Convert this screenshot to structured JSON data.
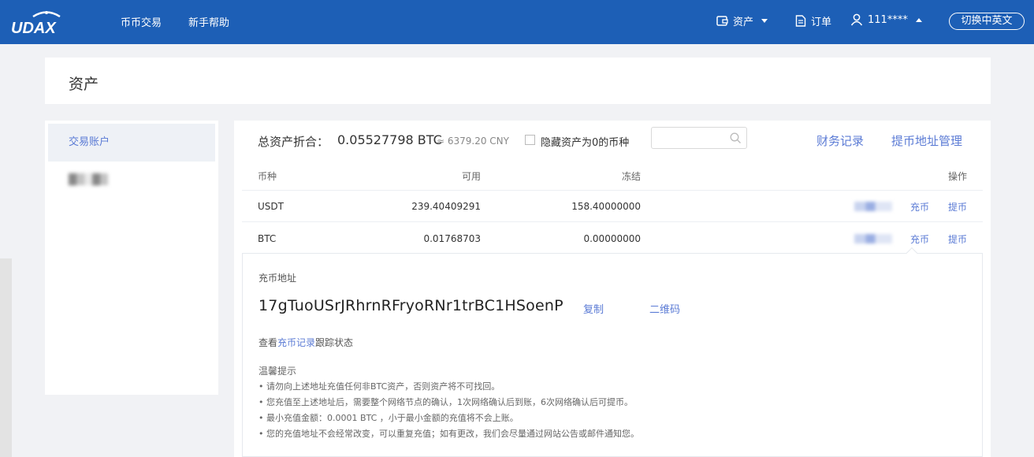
{
  "header": {
    "logo_text": "UDAX",
    "nav": [
      "币币交易",
      "新手帮助"
    ],
    "assets_label": "资产",
    "orders_label": "订单",
    "user_label": "111****",
    "lang_button": "切换中英文"
  },
  "page": {
    "title": "资产"
  },
  "sidebar": {
    "items": [
      {
        "label": "交易账户",
        "active": true
      },
      {
        "label": "█▒░█▒",
        "blurred": true
      }
    ]
  },
  "summary": {
    "total_label": "总资产折合：",
    "total_btc": "0.05527798 BTC",
    "total_cny": "≈ 6379.20 CNY",
    "hide_zero_label": "隐藏资产为0的币种",
    "search_placeholder": "",
    "finance_records": "财务记录",
    "withdraw_address_mgmt": "提币地址管理"
  },
  "table": {
    "headers": {
      "currency": "币种",
      "available": "可用",
      "frozen": "冻结",
      "action": "操作"
    },
    "rows": [
      {
        "currency": "USDT",
        "available": "239.40409291",
        "frozen": "158.40000000",
        "deposit": "充币",
        "withdraw": "提币"
      },
      {
        "currency": "BTC",
        "available": "0.01768703",
        "frozen": "0.00000000",
        "deposit": "充币",
        "withdraw": "提币"
      }
    ]
  },
  "deposit": {
    "label": "充币地址",
    "address": "17gTuoUSrJRhrnRFryoRNr1trBC1HSoenP",
    "copy": "复制",
    "qr": "二维码",
    "track_prefix": "查看",
    "track_link": "充币记录",
    "track_suffix": "跟踪状态",
    "tips_title": "温馨提示",
    "tips": [
      "• 请勿向上述地址充值任何非BTC资产，否则资产将不可找回。",
      "• 您充值至上述地址后，需要整个网络节点的确认，1次网络确认后到账，6次网络确认后可提币。",
      "• 最小充值金额：0.0001 BTC ，小于最小金额的充值将不会上账。",
      "• 您的充值地址不会经常改变，可以重复充值；如有更改，我们会尽量通过网站公告或邮件通知您。"
    ]
  },
  "colors": {
    "header_bg": "#1d5fb6",
    "link": "#5b7bd5",
    "page_bg": "#f1f2f5"
  }
}
